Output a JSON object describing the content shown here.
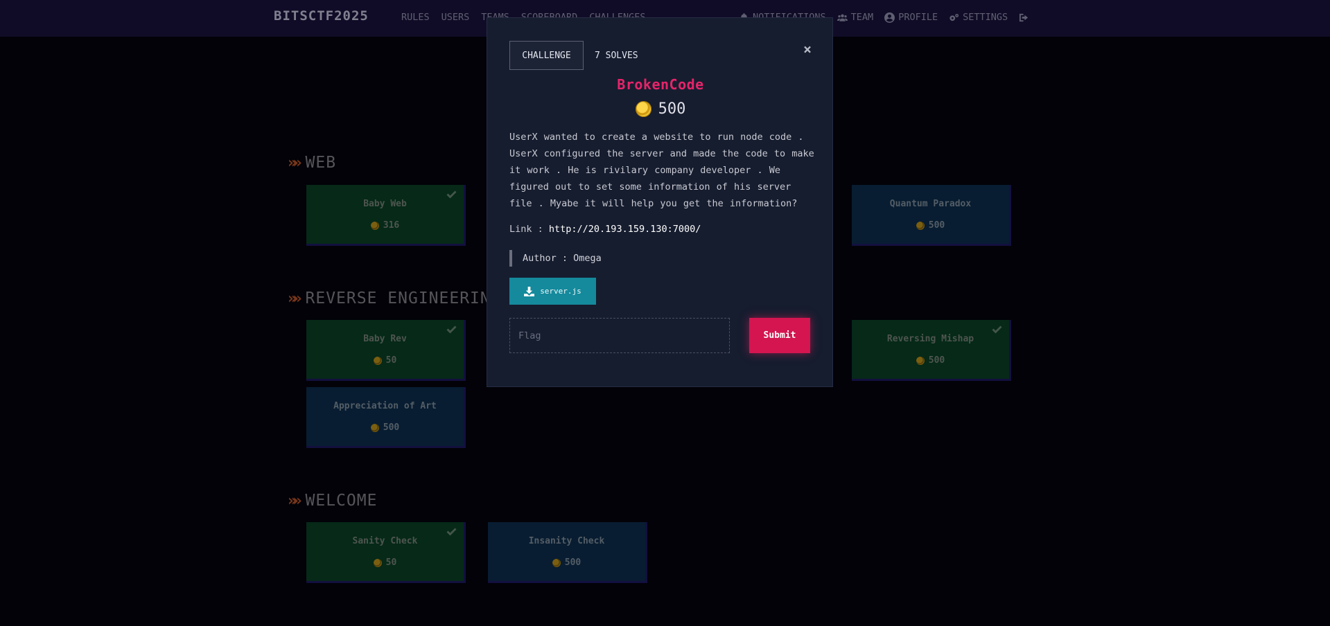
{
  "navbar": {
    "brand": "BITSCTF2025",
    "left_links": [
      "RULES",
      "USERS",
      "TEAMS",
      "SCOREBOARD",
      "CHALLENGES"
    ],
    "notifications": "NOTIFICATIONS",
    "team": "TEAM",
    "profile": "PROFILE",
    "settings": "SETTINGS"
  },
  "categories": {
    "web": {
      "title": "WEB",
      "cards": [
        {
          "name": "Baby Web",
          "value": "316",
          "solved": true
        },
        {
          "name": "Quantum Paradox",
          "value": "500",
          "solved": false
        }
      ]
    },
    "rev": {
      "title": "REVERSE ENGINEERING",
      "cards": [
        {
          "name": "Baby Rev",
          "value": "50",
          "solved": true
        },
        {
          "name": "Reversing Mishap",
          "value": "500",
          "solved": true
        },
        {
          "name": "Appreciation of Art",
          "value": "500",
          "solved": false
        }
      ]
    },
    "welcome": {
      "title": "WELCOME",
      "cards": [
        {
          "name": "Sanity Check",
          "value": "50",
          "solved": true
        },
        {
          "name": "Insanity Check",
          "value": "500",
          "solved": false
        }
      ]
    }
  },
  "modal": {
    "tab_challenge": "CHALLENGE",
    "tab_solves": "7 SOLVES",
    "close": "×",
    "title": "BrokenCode",
    "value": "500",
    "description": "UserX wanted to create a website to run node code . UserX configured the server and made the code to make it work . He is rivilary company developer . We figured out to set some information of his server file . Myabe it will help you get the information?",
    "link_label": "Link : ",
    "link_url": "http://20.193.159.130:7000/",
    "author": "Author : Omega",
    "file_name": "server.js",
    "flag_placeholder": "Flag",
    "submit_label": "Submit"
  },
  "colors": {
    "navbar": "#1a1440",
    "modal_bg": "#161d2f",
    "title_pink": "#e6246a",
    "submit": "#d4154f",
    "file_button": "#148a9c",
    "solved_card": "#0a4327",
    "unsolved_card": "#0e2f4f"
  },
  "icons": {
    "chevron": "double-chevron-icon",
    "check": "check-icon",
    "coin": "coin-icon",
    "bell": "bell-icon",
    "team": "users-icon",
    "profile": "user-circle-icon",
    "settings": "gears-icon",
    "logout": "sign-out-icon",
    "download": "download-icon"
  }
}
